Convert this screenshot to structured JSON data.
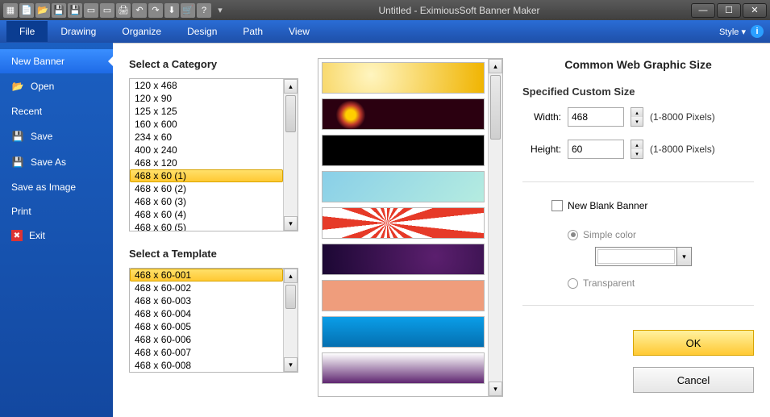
{
  "title": "Untitled - EximiousSoft Banner Maker",
  "menubar": {
    "items": [
      "File",
      "Drawing",
      "Organize",
      "Design",
      "Path",
      "View"
    ],
    "active": 0,
    "style": "Style"
  },
  "sidebar": {
    "items": [
      {
        "label": "New Banner",
        "icon": ""
      },
      {
        "label": "Open",
        "icon": "📂"
      },
      {
        "label": "Recent",
        "icon": ""
      },
      {
        "label": "Save",
        "icon": "💾"
      },
      {
        "label": "Save As",
        "icon": "💾"
      },
      {
        "label": "Save as Image",
        "icon": ""
      },
      {
        "label": "Print",
        "icon": ""
      },
      {
        "label": "Exit",
        "icon": "✖"
      }
    ],
    "highlight": 0
  },
  "category": {
    "label": "Select a Category",
    "items": [
      "120 x 468",
      "120 x 90",
      "125 x 125",
      "160 x 600",
      "234 x 60",
      "400 x 240",
      "468 x 120",
      "468 x 60 (1)",
      "468 x 60 (2)",
      "468 x 60 (3)",
      "468 x 60 (4)",
      "468 x 60 (5)"
    ],
    "selected": 7
  },
  "template": {
    "label": "Select a Template",
    "items": [
      "468 x 60-001",
      "468 x 60-002",
      "468 x 60-003",
      "468 x 60-004",
      "468 x 60-005",
      "468 x 60-006",
      "468 x 60-007",
      "468 x 60-008"
    ],
    "selected": 0
  },
  "right": {
    "title": "Common Web Graphic Size",
    "custom_label": "Specified Custom Size",
    "width_label": "Width:",
    "height_label": "Height:",
    "width": "468",
    "height": "60",
    "range": "(1-8000 Pixels)",
    "blank_label": "New Blank Banner",
    "simple_color": "Simple color",
    "transparent": "Transparent",
    "ok": "OK",
    "cancel": "Cancel"
  }
}
